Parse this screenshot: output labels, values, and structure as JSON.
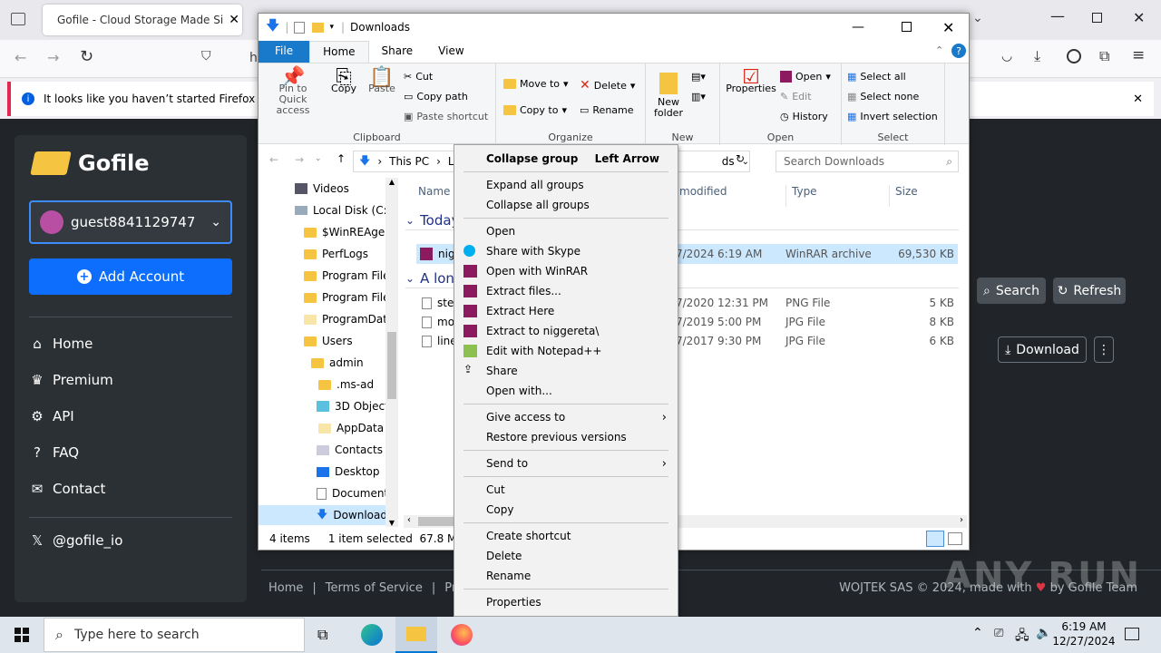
{
  "browser": {
    "tab_title": "Gofile - Cloud Storage Made Si",
    "url_fragment": "h",
    "notification": "It looks like you haven’t started Firefox in a wh"
  },
  "gofile": {
    "brand": "Gofile",
    "account": "guest8841129747",
    "add_account": "Add Account",
    "nav": [
      {
        "label": "Home",
        "icon": "home-icon"
      },
      {
        "label": "Premium",
        "icon": "crown-icon"
      },
      {
        "label": "API",
        "icon": "cogs-icon"
      },
      {
        "label": "FAQ",
        "icon": "question-icon"
      },
      {
        "label": "Contact",
        "icon": "envelope-icon"
      }
    ],
    "social": "@gofile_io",
    "search_btn": "Search",
    "refresh_btn": "Refresh",
    "download_btn": "Download",
    "footer": {
      "home": "Home",
      "tos": "Terms of Service",
      "privacy": "Priva",
      "company": "WOJTEK SAS © 2024, made with",
      "by": "by Gofile Team"
    }
  },
  "explorer": {
    "title": "Downloads",
    "tabs": [
      "File",
      "Home",
      "Share",
      "View"
    ],
    "ribbon": {
      "pin": "Pin to Quick access",
      "copy": "Copy",
      "paste": "Paste",
      "cut": "Cut",
      "copy_path": "Copy path",
      "paste_shortcut": "Paste shortcut",
      "move_to": "Move to",
      "copy_to": "Copy to",
      "delete": "Delete",
      "rename": "Rename",
      "new_folder": "New folder",
      "properties": "Properties",
      "open": "Open",
      "edit": "Edit",
      "history": "History",
      "select_all": "Select all",
      "select_none": "Select none",
      "invert": "Invert selection",
      "groups": [
        "Clipboard",
        "Organize",
        "New",
        "Open",
        "Select"
      ]
    },
    "address": {
      "this_pc": "This PC",
      "next": "Lo",
      "tail": "ds",
      "search_placeholder": "Search Downloads"
    },
    "tree": [
      "Videos",
      "Local Disk (C:)",
      "$WinREAgent",
      "PerfLogs",
      "Program Files",
      "Program Files",
      "ProgramData",
      "Users",
      "admin",
      ".ms-ad",
      "3D Objects",
      "AppData",
      "Contacts",
      "Desktop",
      "Documents",
      "Downloads"
    ],
    "columns": {
      "name": "Name",
      "modified": "modified",
      "type": "Type",
      "size": "Size"
    },
    "groups": {
      "today": "Today",
      "long": "A lon"
    },
    "files": [
      {
        "name": "nig",
        "date": "7/2024 6:19 AM",
        "type": "WinRAR archive",
        "size": "69,530 KB"
      },
      {
        "name": "stev",
        "date": "7/2020 12:31 PM",
        "type": "PNG File",
        "size": "5 KB"
      },
      {
        "name": "mo",
        "date": "7/2019 5:00 PM",
        "type": "JPG File",
        "size": "8 KB"
      },
      {
        "name": "line",
        "date": "7/2017 9:30 PM",
        "type": "JPG File",
        "size": "6 KB"
      }
    ],
    "status": {
      "items": "4 items",
      "selected": "1 item selected",
      "size": "67.8 MB"
    }
  },
  "context_menu": {
    "collapse_group": "Collapse group",
    "collapse_shortcut": "Left Arrow",
    "expand_all": "Expand all groups",
    "collapse_all": "Collapse all groups",
    "open": "Open",
    "skype": "Share with Skype",
    "open_winrar": "Open with WinRAR",
    "extract_files": "Extract files...",
    "extract_here": "Extract Here",
    "extract_to": "Extract to niggereta\\",
    "notepad": "Edit with Notepad++",
    "share": "Share",
    "open_with": "Open with...",
    "give_access": "Give access to",
    "restore": "Restore previous versions",
    "send_to": "Send to",
    "cut": "Cut",
    "copy": "Copy",
    "create_shortcut": "Create shortcut",
    "delete": "Delete",
    "rename": "Rename",
    "properties": "Properties"
  },
  "taskbar": {
    "search_placeholder": "Type here to search",
    "time": "6:19 AM",
    "date": "12/27/2024"
  },
  "watermark": "ANY RUN"
}
